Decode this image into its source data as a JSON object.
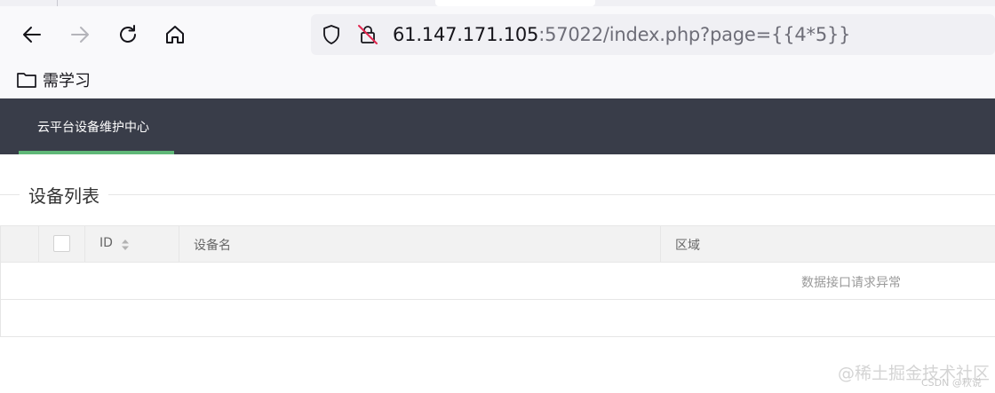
{
  "browser": {
    "back_icon": "arrow-left-icon",
    "forward_icon": "arrow-right-icon",
    "reload_icon": "reload-icon",
    "home_icon": "home-icon",
    "url_host": "61.147.171.105",
    "url_rest": ":57022/index.php?page={{4*5}}",
    "bookmark_label": "需学习"
  },
  "nav": {
    "items": [
      {
        "label": "云平台设备维护中心"
      }
    ],
    "accent": "#5FB878",
    "background": "#393D49"
  },
  "section": {
    "title": "设备列表"
  },
  "table": {
    "columns": [
      "ID",
      "设备名",
      "区域"
    ],
    "empty_message": "数据接口请求异常"
  },
  "watermark": {
    "main": "@稀土掘金技术社区",
    "sub": "CSDN @秋说"
  }
}
